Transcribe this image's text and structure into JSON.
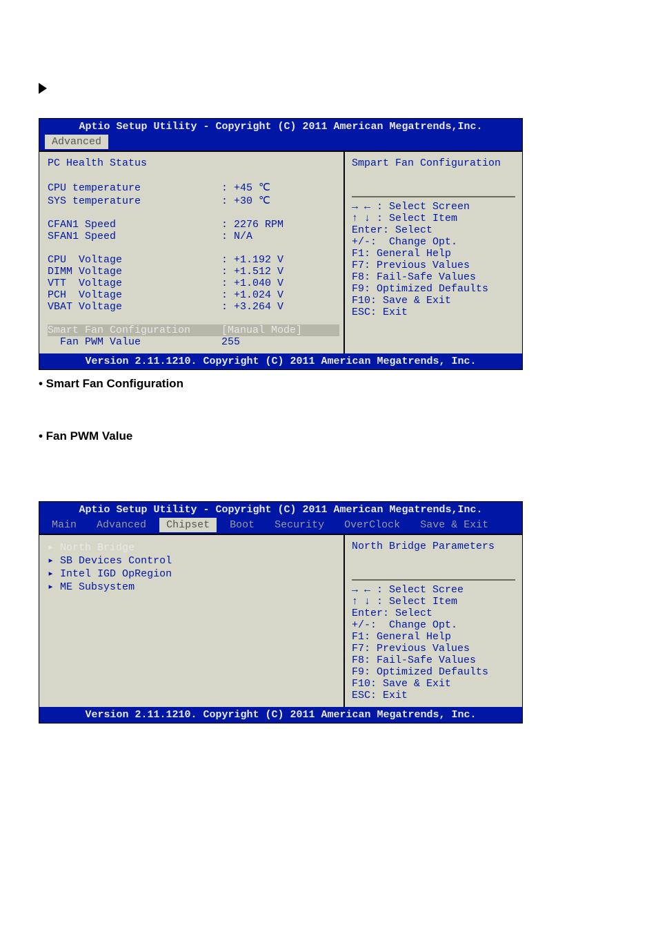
{
  "headings": {
    "smart": "• Smart Fan Configuration",
    "pwm": "• Fan PWM Value"
  },
  "bios1": {
    "header": "Aptio Setup Utility - Copyright (C) 2011 American Megatrends,Inc.",
    "tab": "Advanced",
    "left": {
      "title": "PC Health Status",
      "cpu_t": "CPU temperature             : +45 ℃",
      "sys_t": "SYS temperature             : +30 ℃",
      "cfan": "CFAN1 Speed                 : 2276 RPM",
      "sfan": "SFAN1 Speed                 : N/A",
      "cpu_v": "CPU  Voltage                : +1.192 V",
      "dimm_v": "DIMM Voltage                : +1.512 V",
      "vtt_v": "VTT  Voltage                : +1.040 V",
      "pch_v": "PCH  Voltage                : +1.024 V",
      "vbat_v": "VBAT Voltage                : +3.264 V",
      "smartfan": "Smart Fan Configuration     [Manual Mode]",
      "pwm": "  Fan PWM Value             255"
    },
    "right": {
      "title": "Smpart Fan Configuration",
      "l1": "→ ← : Select Screen",
      "l2": "↑ ↓ : Select Item",
      "l3": "Enter: Select",
      "l4": "+/-:  Change Opt.",
      "l5": "F1: General Help",
      "l6": "F7: Previous Values",
      "l7": "F8: Fail-Safe Values",
      "l8": "F9: Optimized Defaults",
      "l9": "F10: Save & Exit",
      "l10": "ESC: Exit"
    },
    "footer": "Version 2.11.1210. Copyright (C) 2011 American Megatrends, Inc."
  },
  "bios2": {
    "header": "Aptio Setup Utility - Copyright (C) 2011 American Megatrends,Inc.",
    "tabs": [
      "Main",
      "Advanced",
      "Chipset",
      "Boot",
      "Security",
      "OverClock",
      "Save & Exit"
    ],
    "left": [
      "North Bridge",
      "SB Devices Control",
      "Intel IGD OpRegion",
      "ME Subsystem"
    ],
    "right": {
      "title": "North Bridge Parameters",
      "l1": "→ ← : Select Scree",
      "l2": "↑ ↓ : Select Item",
      "l3": "Enter: Select",
      "l4": "+/-:  Change Opt.",
      "l5": "F1: General Help",
      "l6": "F7: Previous Values",
      "l7": "F8: Fail-Safe Values",
      "l8": "F9: Optimized Defaults",
      "l9": "F10: Save & Exit",
      "l10": "ESC: Exit"
    },
    "footer": "Version 2.11.1210. Copyright (C) 2011 American Megatrends, Inc."
  }
}
